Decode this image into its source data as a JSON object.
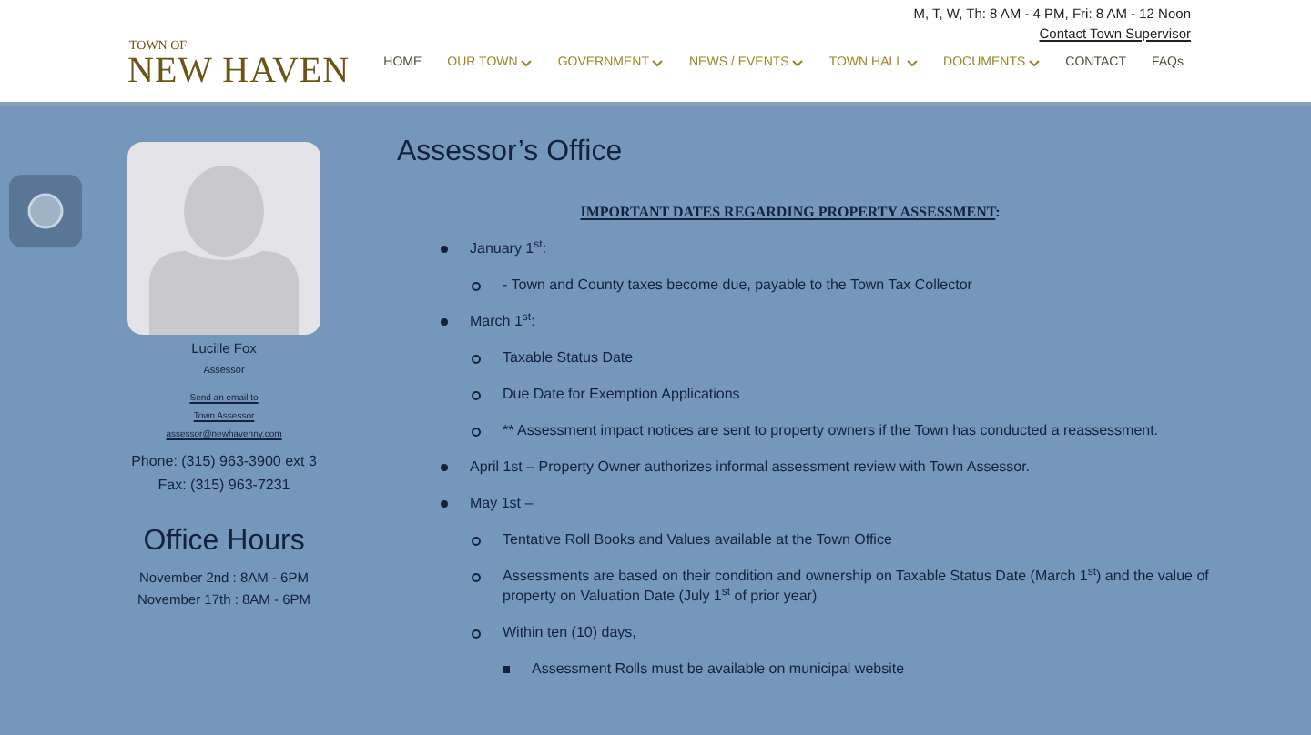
{
  "top_bar": {
    "hours": "M, T, W, Th: 8 AM - 4 PM, Fri: 8 AM - 12 Noon",
    "contact_link": "Contact Town Supervisor"
  },
  "logo": {
    "small": "TOWN OF",
    "large": "NEW HAVEN"
  },
  "nav": [
    {
      "label": "HOME",
      "has_menu": false
    },
    {
      "label": "OUR TOWN",
      "has_menu": true
    },
    {
      "label": "GOVERNMENT",
      "has_menu": true
    },
    {
      "label": "NEWS / EVENTS",
      "has_menu": true
    },
    {
      "label": "TOWN HALL",
      "has_menu": true
    },
    {
      "label": "DOCUMENTS",
      "has_menu": true
    },
    {
      "label": "CONTACT",
      "has_menu": false
    },
    {
      "label": "FAQs",
      "has_menu": false
    }
  ],
  "profile": {
    "name": "Lucille Fox",
    "role": "Assessor",
    "email_links": [
      "Send an email to",
      "Town Assessor",
      "assessor@newhavenny.com"
    ],
    "phone": "Phone: (315) 963-3900 ext 3",
    "fax": "Fax: (315) 963-7231"
  },
  "office_hours": {
    "title": "Office Hours",
    "lines": [
      "November 2nd : 8AM - 6PM",
      "November 17th : 8AM - 6PM"
    ]
  },
  "page_title": "Assessor’s Office",
  "section_heading": "IMPORTANT DATES REGARDING PROPERTY ASSESSMENT",
  "section_heading_suffix": ":",
  "dates": [
    {
      "text": "January 1$^{st}$:",
      "children": [
        {
          "text": "- Town and County taxes become due, payable to the Town Tax Collector"
        }
      ]
    },
    {
      "text": "March 1$^{st}$:",
      "children": [
        {
          "text": "Taxable Status Date"
        },
        {
          "text": "Due Date for Exemption Applications"
        },
        {
          "text": "** Assessment impact notices are sent to property owners if the Town has conducted a reassessment."
        }
      ]
    },
    {
      "text": "April 1st – Property Owner authorizes informal assessment review with Town Assessor."
    },
    {
      "text": "May 1st –",
      "children": [
        {
          "text": "Tentative Roll Books and Values available at the Town Office"
        },
        {
          "text": "Assessments are based on their condition and ownership on Taxable Status Date (March 1$^{st}$) and the value of property on Valuation Date (July 1$^{st}$ of prior year)"
        },
        {
          "text": "Within ten (10) days,",
          "children": [
            {
              "text": "Assessment Rolls must be available on municipal website"
            }
          ]
        }
      ]
    }
  ]
}
